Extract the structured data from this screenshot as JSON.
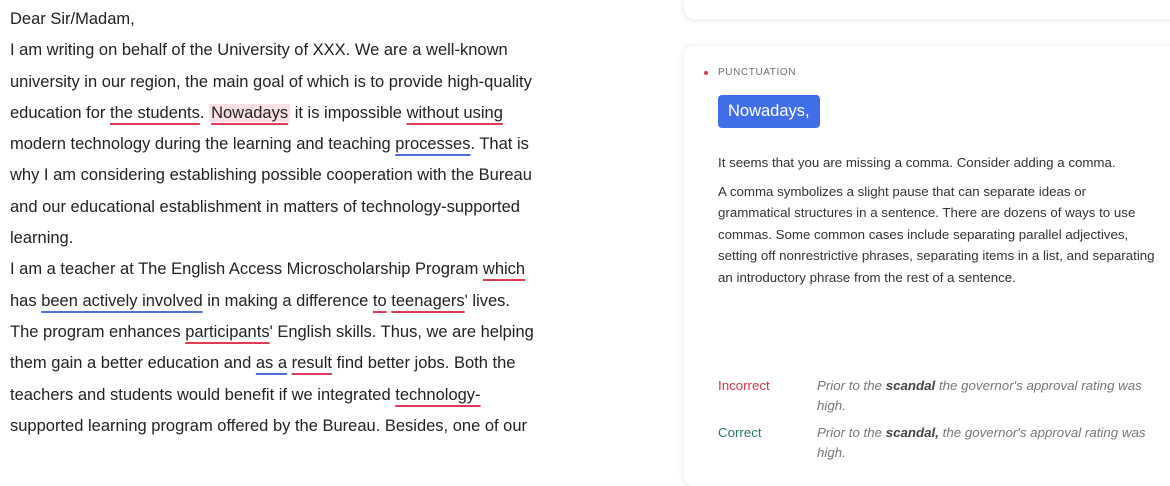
{
  "editor": {
    "lines": {
      "l1": "Dear Sir/Madam,",
      "l2": "I am writing on behalf of the University of XXX. We are a well-known",
      "l3": "university in our region, the main goal of which is to provide high-quality",
      "l4": {
        "a": "education for ",
        "b": "the students",
        "c": ". ",
        "d": "Nowadays",
        "e": " it is impossible ",
        "f": "without using"
      },
      "l5": {
        "a": "modern technology during the learning and teaching ",
        "b": "processes",
        "c": ". That is"
      },
      "l6": "why I am considering establishing possible cooperation with the Bureau",
      "l7": "and our educational establishment in matters of technology-supported",
      "l8": "learning.",
      "l9": {
        "a": "I am a teacher at The English Access Microscholarship Program ",
        "b": "which"
      },
      "l10": {
        "a": "has ",
        "b": "been actively involved",
        "c": " in making a difference ",
        "d": "to",
        "e": " ",
        "f": "teenagers",
        "g": "' lives."
      },
      "l11": {
        "a": "The program enhances ",
        "b": "participants",
        "c": "' English skills. Thus, we are helping"
      },
      "l12": {
        "a": "them gain a better education and ",
        "b": "as a",
        "c": " ",
        "d": "result",
        "e": " find better jobs. Both the"
      },
      "l13": {
        "a": "teachers and students would benefit if we integrated ",
        "b": "technology-"
      },
      "l14": "supported learning program offered by the Bureau. Besides, one of our"
    }
  },
  "sidebar": {
    "category": "PUNCTUATION",
    "suggestion": "Nowadays,",
    "summary": "It seems that you are missing a comma. Consider adding a comma.",
    "explanation": "A comma symbolizes a slight pause that can separate ideas or grammatical structures in a sentence. There are dozens of ways to use commas. Some common cases include separating parallel adjectives, setting off nonrestrictive phrases, separating items in a list, and separating an introductory phrase from the rest of a sentence.",
    "examples": {
      "incorrect": {
        "label": "Incorrect",
        "pre": "Prior to the ",
        "bold": "scandal",
        "post": " the governor's approval rating was high."
      },
      "correct": {
        "label": "Correct",
        "pre": "Prior to the ",
        "bold": "scandal,",
        "post": " the governor's approval rating was high."
      }
    }
  },
  "colors": {
    "error_underline": "#e03b56",
    "style_underline": "#4f6fd6",
    "highlight": "#fde0e4",
    "suggestion_button": "#3f6ee6"
  }
}
